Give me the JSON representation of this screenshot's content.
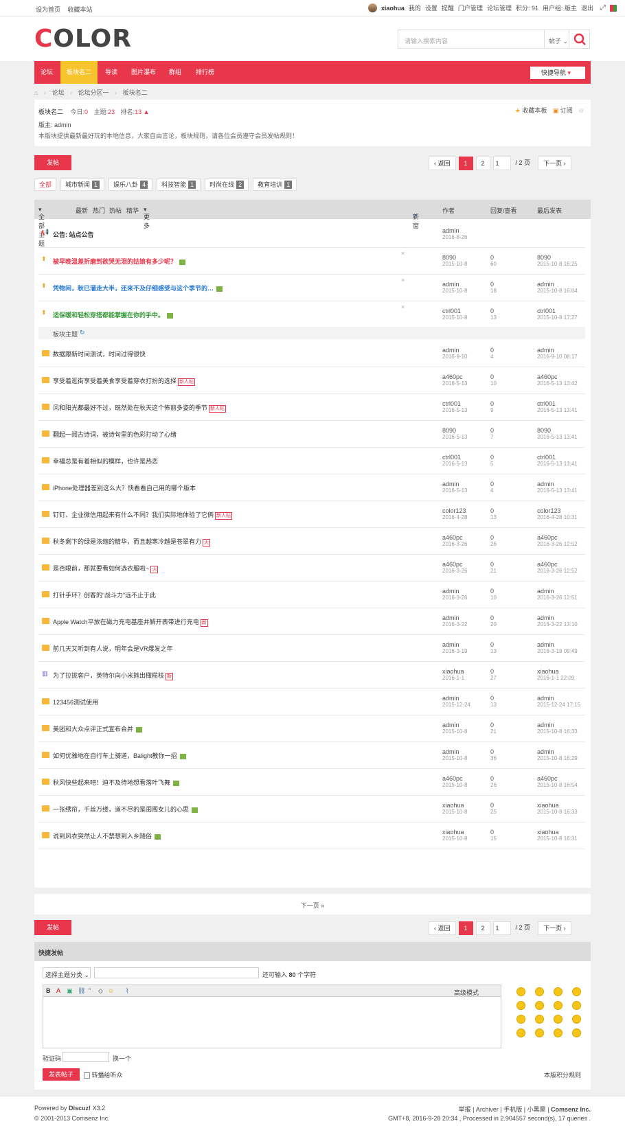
{
  "topbar": {
    "left": [
      "设为首页",
      "收藏本站"
    ],
    "username": "xiaohua",
    "links": [
      "我的",
      "设置",
      "提醒",
      "门户管理",
      "论坛管理",
      "积分: 91",
      "用户组: 版主",
      "退出"
    ]
  },
  "header": {
    "logo_a": "C",
    "logo_b": "OLOR",
    "search_placeholder": "请输入搜索内容",
    "search_type": "帖子"
  },
  "nav": {
    "items": [
      "论坛",
      "板块名二",
      "导读",
      "图片瀑布",
      "群组",
      "排行榜"
    ],
    "quick": "快捷导航"
  },
  "breadcrumb": [
    "论坛",
    "论坛分区一",
    "板块名二"
  ],
  "forum": {
    "name": "板块名二",
    "today_label": "今日:",
    "today": "0",
    "topics_label": "主题:",
    "topics": "23",
    "rank_label": "排名:",
    "rank": "13",
    "fav": "收藏本板",
    "subscribe": "订阅",
    "moderator": "版主: admin",
    "desc": "本版块提供最新最好玩的本地信息，大家自由言论，板块规则，请各位会员遵守会员发帖规则！"
  },
  "pager": {
    "post": "发帖",
    "back": "返回",
    "p1": "1",
    "p2": "2",
    "input": "1",
    "total": "/ 2 页",
    "next": "下一页"
  },
  "cats": [
    {
      "label": "全部",
      "n": ""
    },
    {
      "label": "城市新闻",
      "n": "1"
    },
    {
      "label": "娱乐八卦",
      "n": "4"
    },
    {
      "label": "科技智能",
      "n": "1"
    },
    {
      "label": "时尚在线",
      "n": "2"
    },
    {
      "label": "教育培训",
      "n": "1"
    }
  ],
  "thead": {
    "all": "全部主题",
    "latest": "最新",
    "hot": "热门",
    "hotpost": "热帖",
    "digest": "精华",
    "more": "更多",
    "newwin": "新窗",
    "author": "作者",
    "replies": "回复/查看",
    "lastpost": "最后发表"
  },
  "announce": {
    "title": "公告: 站点公告",
    "author": "admin",
    "date": "2016-8-26"
  },
  "sticky": [
    {
      "title": "被早晚温差折磨到欲哭无泪的姑娘有多少呢？",
      "author": "8090",
      "date": "2015-10-8",
      "r": "0",
      "v": "60",
      "lp": "8090",
      "lpd": "2015-10-8 16:25"
    },
    {
      "title": "凭物间，秋已溜走大半，还来不及仔细感受与这个季节的…",
      "author": "admin",
      "date": "2015-10-8",
      "r": "0",
      "v": "18",
      "lp": "admin",
      "lpd": "2015-10-8 16:04"
    },
    {
      "title": "适保暖和轻松穿搭都能掌握在你的手中。",
      "author": "ctrl001",
      "date": "2015-10-8",
      "r": "0",
      "v": "13",
      "lp": "ctrl001",
      "lpd": "2015-10-8 17:27"
    }
  ],
  "section_label": "板块主题",
  "threads": [
    {
      "title": "数据跟新时间测试，时间过得很快",
      "tag": "",
      "author": "admin",
      "date": "2016-9-10",
      "r": "0",
      "v": "4",
      "lp": "admin",
      "lpd": "2016-9-10 08:17"
    },
    {
      "title": "享受着逛街享受着美食享受着穿衣打扮的选择",
      "tag": "新人帖",
      "author": "a460pc",
      "date": "2016-5-13",
      "r": "0",
      "v": "10",
      "lp": "a460pc",
      "lpd": "2016-5-13 13:42"
    },
    {
      "title": "风和阳光都最好不过，既然处在秋天这个佈丽多姿的季节",
      "tag": "新人帖",
      "author": "ctrl001",
      "date": "2016-5-13",
      "r": "0",
      "v": "9",
      "lp": "ctrl001",
      "lpd": "2016-5-13 13:41"
    },
    {
      "title": "翻起一阅古诗词，被诗句里的色彩打动了心绪",
      "tag": "",
      "author": "8090",
      "date": "2016-5-13",
      "r": "0",
      "v": "7",
      "lp": "8090",
      "lpd": "2016-5-13 13:41"
    },
    {
      "title": "幸福总是有着相似的模样，也许是热恋",
      "tag": "",
      "author": "ctrl001",
      "date": "2016-5-13",
      "r": "0",
      "v": "5",
      "lp": "ctrl001",
      "lpd": "2016-5-13 13:41"
    },
    {
      "title": "iPhone处理器差别这么大？快看看自己用的哪个版本",
      "tag": "",
      "author": "admin",
      "date": "2016-5-13",
      "r": "0",
      "v": "4",
      "lp": "admin",
      "lpd": "2016-5-13 13:41"
    },
    {
      "title": "钉钉、企业微信用起来有什么不同？我们实际地体验了它俩",
      "tag": "新人帖",
      "author": "color123",
      "date": "2016-4-28",
      "r": "0",
      "v": "13",
      "lp": "color123",
      "lpd": "2016-4-28 10:31"
    },
    {
      "title": "秋冬剩下的绿是浓缩的精华，而且越寒冷越是苍翠有力",
      "tag": "火",
      "author": "a460pc",
      "date": "2016-3-26",
      "r": "0",
      "v": "26",
      "lp": "a460pc",
      "lpd": "2016-3-26 12:52"
    },
    {
      "title": "是否眼前，那就要看如何选衣服啦~",
      "tag": "火",
      "author": "a460pc",
      "date": "2016-3-26",
      "r": "0",
      "v": "21",
      "lp": "a460pc",
      "lpd": "2016-3-26 12:52"
    },
    {
      "title": "打针手环？创客的“战斗力”远不止于此",
      "tag": "",
      "author": "admin",
      "date": "2016-3-26",
      "r": "0",
      "v": "10",
      "lp": "admin",
      "lpd": "2016-3-26 12:51"
    },
    {
      "title": "Apple Watch平放在磁力充电基座并解开表带进行充电",
      "tag": "新",
      "author": "admin",
      "date": "2016-3-22",
      "r": "0",
      "v": "20",
      "lp": "admin",
      "lpd": "2016-3-22 13:10"
    },
    {
      "title": "前几天又听到有人说，明年会是VR爆发之年",
      "tag": "",
      "author": "admin",
      "date": "2016-3-19",
      "r": "0",
      "v": "13",
      "lp": "admin",
      "lpd": "2016-3-19 09:49"
    },
    {
      "title": "为了拉拢客户，英特尔向小米抛出橄榄枝",
      "tag": "新",
      "author": "xiaohua",
      "date": "2016-1-1",
      "r": "0",
      "v": "27",
      "lp": "xiaohua",
      "lpd": "2016-1-1 22:09"
    },
    {
      "title": "123456测试使用",
      "tag": "",
      "author": "admin",
      "date": "2015-12-24",
      "r": "0",
      "v": "13",
      "lp": "admin",
      "lpd": "2015-12-24 17:15"
    },
    {
      "title": "美团和大众点评正式宣布合并",
      "tag": "img",
      "author": "admin",
      "date": "2015-10-8",
      "r": "0",
      "v": "21",
      "lp": "admin",
      "lpd": "2015-10-8 16:33"
    },
    {
      "title": "如何优雅地在自行车上骑道，Balight教你一招",
      "tag": "img",
      "author": "admin",
      "date": "2015-10-8",
      "r": "0",
      "v": "36",
      "lp": "admin",
      "lpd": "2015-10-8 16:29"
    },
    {
      "title": "秋风快些起来吧！迫不及待地想看落叶飞舞",
      "tag": "img",
      "author": "a460pc",
      "date": "2015-10-8",
      "r": "0",
      "v": "26",
      "lp": "a460pc",
      "lpd": "2015-10-8 16:54"
    },
    {
      "title": "一张绣帘，千丝万缕，道不尽的是闺阁女儿的心思",
      "tag": "img",
      "author": "xiaohua",
      "date": "2015-10-8",
      "r": "0",
      "v": "25",
      "lp": "xiaohua",
      "lpd": "2015-10-8 16:33"
    },
    {
      "title": "说到风衣突然让人不禁想到入乡随俗",
      "tag": "img",
      "author": "xiaohua",
      "date": "2015-10-8",
      "r": "0",
      "v": "15",
      "lp": "xiaohua",
      "lpd": "2015-10-8 16:31"
    }
  ],
  "next_page": "下一页 »",
  "quick_post": {
    "title": "快捷发帖",
    "category": "选择主题分类",
    "remaining_prefix": "还可输入",
    "remaining": "80",
    "remaining_suffix": "个字符",
    "advanced": "高级模式",
    "captcha": "验证码",
    "change": "换一个",
    "submit": "发表帖子",
    "broadcast": "转播给听众",
    "rules": "本版积分规则"
  },
  "footer": {
    "powered": "Powered by",
    "brand": "Discuz!",
    "version": "X3.2",
    "copyright": "© 2001-2013 Comsenz Inc.",
    "links": [
      "举报",
      "Archiver",
      "手机版",
      "小黑屋",
      "Comsenz Inc."
    ],
    "stats": "GMT+8, 2016-9-28 20:34 , Processed in 2.904557 second(s), 17 queries ."
  },
  "colors": {
    "accent": "#e8364b",
    "nav_active": "#f8c42d"
  }
}
